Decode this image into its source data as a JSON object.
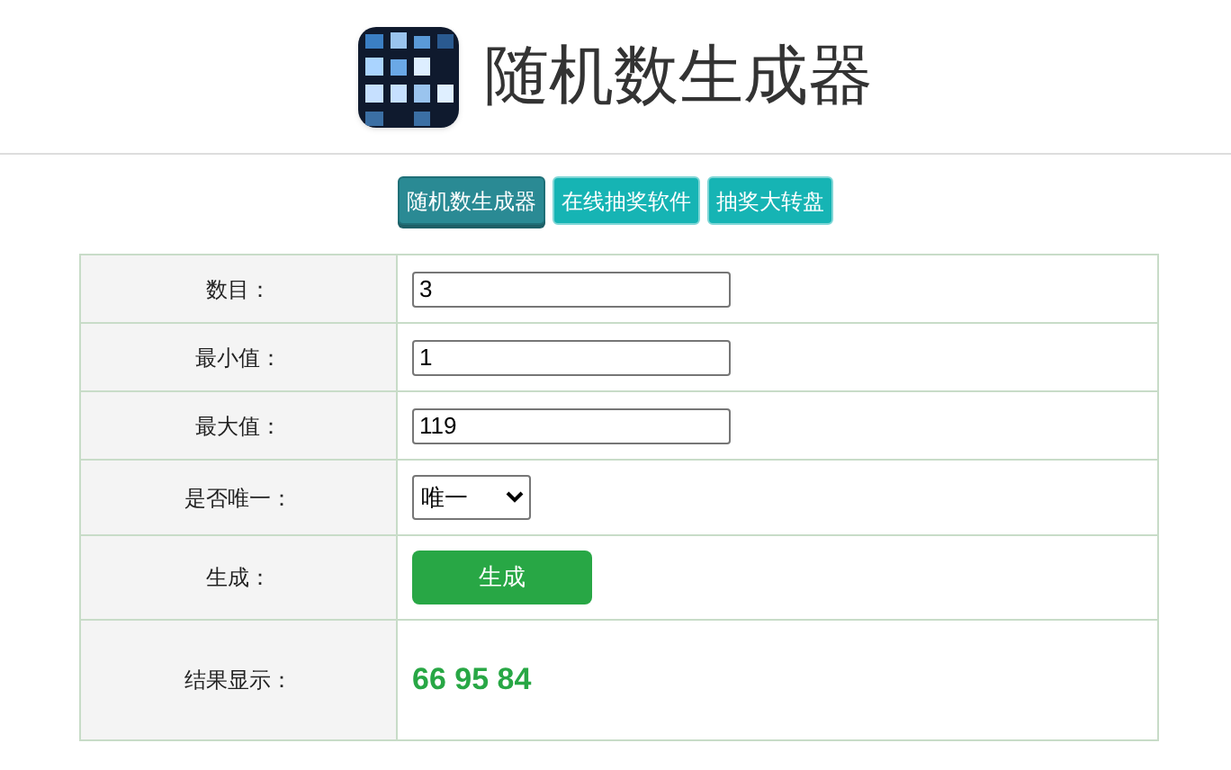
{
  "header": {
    "title": "随机数生成器"
  },
  "nav": [
    {
      "label": "随机数生成器",
      "selected": true
    },
    {
      "label": "在线抽奖软件",
      "selected": false
    },
    {
      "label": "抽奖大转盘",
      "selected": false
    }
  ],
  "form": [
    {
      "kind": "input",
      "label": "数目：",
      "value": "3"
    },
    {
      "kind": "input",
      "label": "最小值：",
      "value": "1"
    },
    {
      "kind": "input",
      "label": "最大值：",
      "value": "119"
    },
    {
      "kind": "select",
      "label": "是否唯一：",
      "value": "唯一"
    },
    {
      "kind": "button",
      "label": "生成：",
      "value": "生成"
    },
    {
      "kind": "result",
      "label": "结果显示：",
      "value": "66 95 84"
    }
  ]
}
